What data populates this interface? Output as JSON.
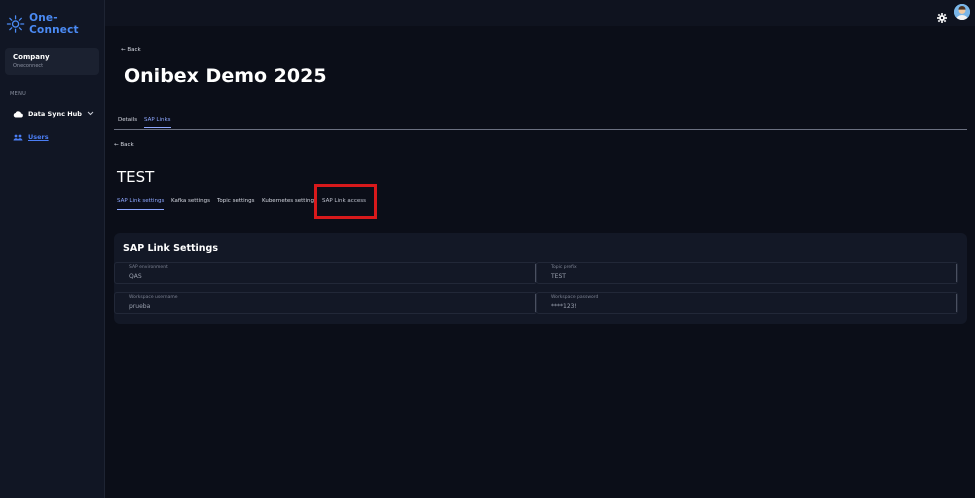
{
  "app": {
    "name": "One-Connect",
    "brand_color": "#4b8bf5"
  },
  "sidebar": {
    "company": {
      "name": "Company",
      "subtitle": "Oneconnect"
    },
    "menu_label": "MENU",
    "items": [
      {
        "label": "Data Sync Hub",
        "icon": "cloud-icon",
        "has_chevron": true
      },
      {
        "label": "Users",
        "icon": "users-icon",
        "active": true
      }
    ]
  },
  "topbar": {
    "settings_icon": "gear-icon",
    "avatar_icon": "avatar"
  },
  "page": {
    "back_label": "← Back",
    "title": "Onibex Demo 2025",
    "tabs": [
      {
        "label": "Details"
      },
      {
        "label": "SAP Links",
        "active": true
      }
    ]
  },
  "sap_link": {
    "back_label": "← Back",
    "title": "TEST",
    "tabs": [
      {
        "label": "SAP Link settings",
        "active": true
      },
      {
        "label": "Kafka settings"
      },
      {
        "label": "Topic settings"
      },
      {
        "label": "Kubernetes settings"
      },
      {
        "label": "SAP Link access",
        "highlighted": true
      }
    ],
    "highlight_color": "#d8191b"
  },
  "settings_card": {
    "title": "SAP Link Settings",
    "fields": [
      {
        "label": "SAP environment",
        "value": "QAS"
      },
      {
        "label": "Topic prefix",
        "value": "TEST"
      },
      {
        "label": "Workspace username",
        "value": "prueba"
      },
      {
        "label": "Workspace password",
        "value": "****123!"
      }
    ]
  }
}
